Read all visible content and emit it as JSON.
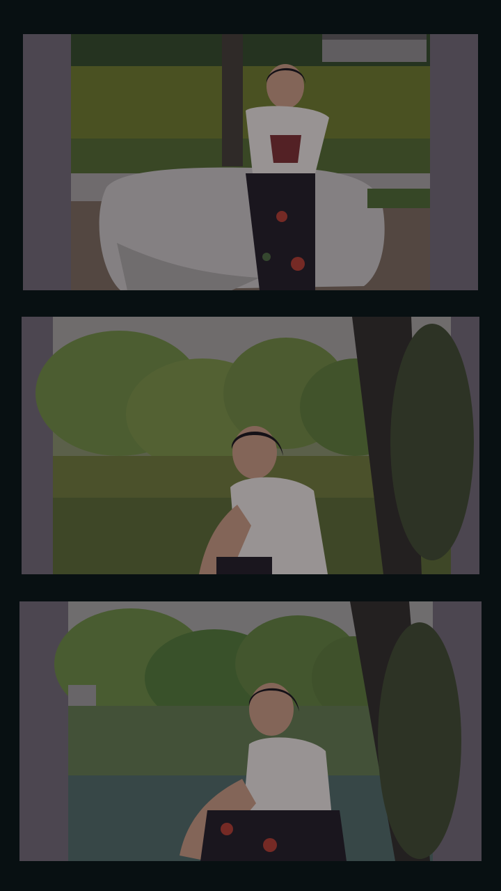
{
  "colors": {
    "background": "#081012",
    "frame_side": "#6e6870",
    "water_green": "#6e7a2a",
    "foliage": "#4f7a33",
    "rock": "#c9c6c2",
    "blouse": "#e9e4dc",
    "skirt": "#1e1a20",
    "tree_trunk": "#2d2a22",
    "hair": "#151214"
  },
  "photos": [
    {
      "subject": "woman-seated-on-rock-by-lake"
    },
    {
      "subject": "woman-leaning-by-lake-blurred-trees"
    },
    {
      "subject": "woman-smiling-by-lake-with-tree-trunk"
    }
  ]
}
